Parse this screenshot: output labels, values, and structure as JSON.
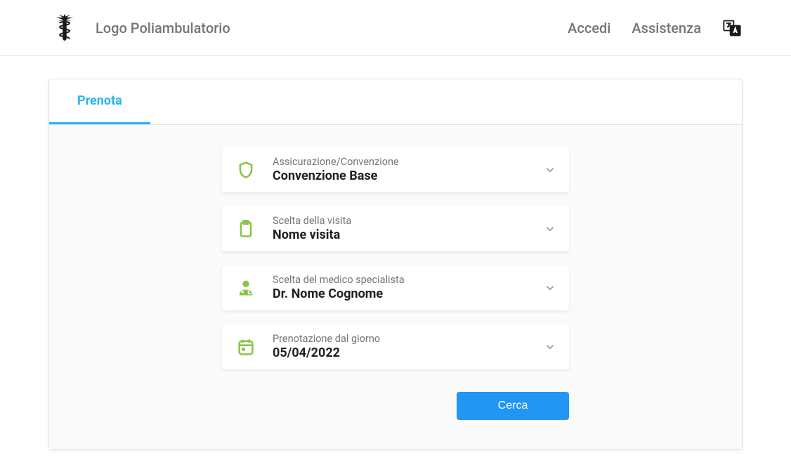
{
  "header": {
    "logo_text": "Logo Poliambulatorio",
    "login_label": "Accedi",
    "assistance_label": "Assistenza"
  },
  "tabs": {
    "book_label": "Prenota"
  },
  "form": {
    "insurance": {
      "label": "Assicurazione/Convenzione",
      "value": "Convenzione Base"
    },
    "visit": {
      "label": "Scelta della visita",
      "value": "Nome visita"
    },
    "doctor": {
      "label": "Scelta del medico specialista",
      "value": "Dr. Nome Cognome"
    },
    "date": {
      "label": "Prenotazione dal giorno",
      "value": "05/04/2022"
    },
    "search_button": "Cerca"
  }
}
